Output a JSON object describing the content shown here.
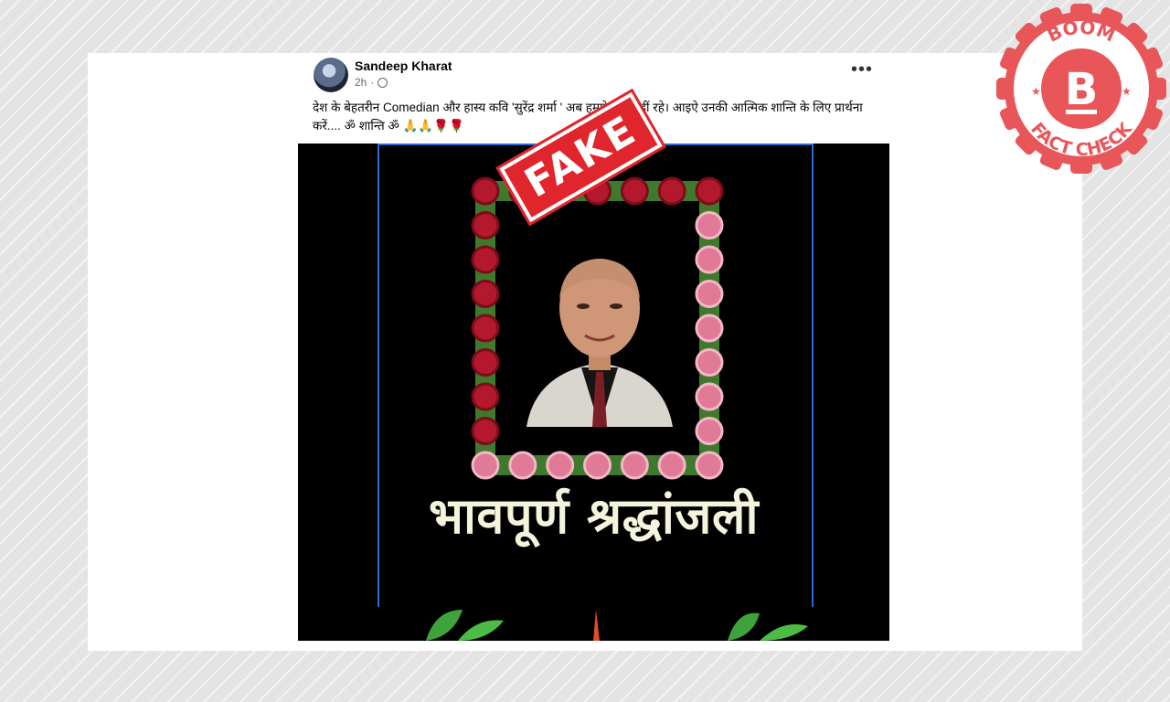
{
  "post": {
    "author": "Sandeep Kharat",
    "time": "2h",
    "menu_glyph": "•••",
    "caption": "देश के बेहतरीन Comedian और हास्य कवि 'सुरेंद्र शर्मा ' अब हमारे बीच नहीं रहे। आइऐ उनकी आत्मिक शान्ति के लिए प्रार्थना करें.... ॐ शान्ति ॐ 🙏🙏🌹🌹",
    "image_text": "भावपूर्ण श्रद्धांजली"
  },
  "stamp": {
    "label": "FAKE"
  },
  "badge": {
    "top_text": "BOOM",
    "letter": "B",
    "bottom_text": "FACT CHECK",
    "brand_color": "#e8565a"
  },
  "icons": {
    "globe": "globe-icon",
    "more": "more-options-icon"
  }
}
